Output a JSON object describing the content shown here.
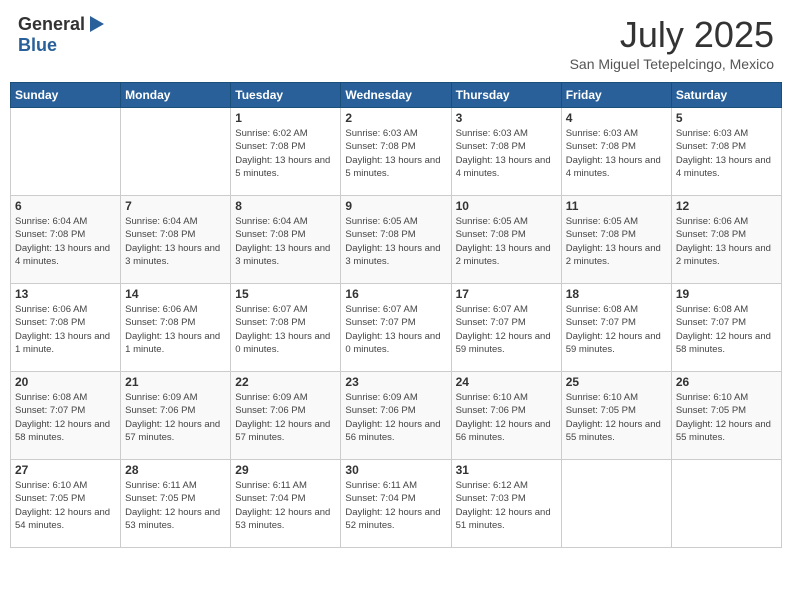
{
  "header": {
    "logo_general": "General",
    "logo_blue": "Blue",
    "month": "July 2025",
    "location": "San Miguel Tetepelcingo, Mexico"
  },
  "days_of_week": [
    "Sunday",
    "Monday",
    "Tuesday",
    "Wednesday",
    "Thursday",
    "Friday",
    "Saturday"
  ],
  "weeks": [
    [
      {
        "day": "",
        "info": ""
      },
      {
        "day": "",
        "info": ""
      },
      {
        "day": "1",
        "info": "Sunrise: 6:02 AM\nSunset: 7:08 PM\nDaylight: 13 hours and 5 minutes."
      },
      {
        "day": "2",
        "info": "Sunrise: 6:03 AM\nSunset: 7:08 PM\nDaylight: 13 hours and 5 minutes."
      },
      {
        "day": "3",
        "info": "Sunrise: 6:03 AM\nSunset: 7:08 PM\nDaylight: 13 hours and 4 minutes."
      },
      {
        "day": "4",
        "info": "Sunrise: 6:03 AM\nSunset: 7:08 PM\nDaylight: 13 hours and 4 minutes."
      },
      {
        "day": "5",
        "info": "Sunrise: 6:03 AM\nSunset: 7:08 PM\nDaylight: 13 hours and 4 minutes."
      }
    ],
    [
      {
        "day": "6",
        "info": "Sunrise: 6:04 AM\nSunset: 7:08 PM\nDaylight: 13 hours and 4 minutes."
      },
      {
        "day": "7",
        "info": "Sunrise: 6:04 AM\nSunset: 7:08 PM\nDaylight: 13 hours and 3 minutes."
      },
      {
        "day": "8",
        "info": "Sunrise: 6:04 AM\nSunset: 7:08 PM\nDaylight: 13 hours and 3 minutes."
      },
      {
        "day": "9",
        "info": "Sunrise: 6:05 AM\nSunset: 7:08 PM\nDaylight: 13 hours and 3 minutes."
      },
      {
        "day": "10",
        "info": "Sunrise: 6:05 AM\nSunset: 7:08 PM\nDaylight: 13 hours and 2 minutes."
      },
      {
        "day": "11",
        "info": "Sunrise: 6:05 AM\nSunset: 7:08 PM\nDaylight: 13 hours and 2 minutes."
      },
      {
        "day": "12",
        "info": "Sunrise: 6:06 AM\nSunset: 7:08 PM\nDaylight: 13 hours and 2 minutes."
      }
    ],
    [
      {
        "day": "13",
        "info": "Sunrise: 6:06 AM\nSunset: 7:08 PM\nDaylight: 13 hours and 1 minute."
      },
      {
        "day": "14",
        "info": "Sunrise: 6:06 AM\nSunset: 7:08 PM\nDaylight: 13 hours and 1 minute."
      },
      {
        "day": "15",
        "info": "Sunrise: 6:07 AM\nSunset: 7:08 PM\nDaylight: 13 hours and 0 minutes."
      },
      {
        "day": "16",
        "info": "Sunrise: 6:07 AM\nSunset: 7:07 PM\nDaylight: 13 hours and 0 minutes."
      },
      {
        "day": "17",
        "info": "Sunrise: 6:07 AM\nSunset: 7:07 PM\nDaylight: 12 hours and 59 minutes."
      },
      {
        "day": "18",
        "info": "Sunrise: 6:08 AM\nSunset: 7:07 PM\nDaylight: 12 hours and 59 minutes."
      },
      {
        "day": "19",
        "info": "Sunrise: 6:08 AM\nSunset: 7:07 PM\nDaylight: 12 hours and 58 minutes."
      }
    ],
    [
      {
        "day": "20",
        "info": "Sunrise: 6:08 AM\nSunset: 7:07 PM\nDaylight: 12 hours and 58 minutes."
      },
      {
        "day": "21",
        "info": "Sunrise: 6:09 AM\nSunset: 7:06 PM\nDaylight: 12 hours and 57 minutes."
      },
      {
        "day": "22",
        "info": "Sunrise: 6:09 AM\nSunset: 7:06 PM\nDaylight: 12 hours and 57 minutes."
      },
      {
        "day": "23",
        "info": "Sunrise: 6:09 AM\nSunset: 7:06 PM\nDaylight: 12 hours and 56 minutes."
      },
      {
        "day": "24",
        "info": "Sunrise: 6:10 AM\nSunset: 7:06 PM\nDaylight: 12 hours and 56 minutes."
      },
      {
        "day": "25",
        "info": "Sunrise: 6:10 AM\nSunset: 7:05 PM\nDaylight: 12 hours and 55 minutes."
      },
      {
        "day": "26",
        "info": "Sunrise: 6:10 AM\nSunset: 7:05 PM\nDaylight: 12 hours and 55 minutes."
      }
    ],
    [
      {
        "day": "27",
        "info": "Sunrise: 6:10 AM\nSunset: 7:05 PM\nDaylight: 12 hours and 54 minutes."
      },
      {
        "day": "28",
        "info": "Sunrise: 6:11 AM\nSunset: 7:05 PM\nDaylight: 12 hours and 53 minutes."
      },
      {
        "day": "29",
        "info": "Sunrise: 6:11 AM\nSunset: 7:04 PM\nDaylight: 12 hours and 53 minutes."
      },
      {
        "day": "30",
        "info": "Sunrise: 6:11 AM\nSunset: 7:04 PM\nDaylight: 12 hours and 52 minutes."
      },
      {
        "day": "31",
        "info": "Sunrise: 6:12 AM\nSunset: 7:03 PM\nDaylight: 12 hours and 51 minutes."
      },
      {
        "day": "",
        "info": ""
      },
      {
        "day": "",
        "info": ""
      }
    ]
  ]
}
